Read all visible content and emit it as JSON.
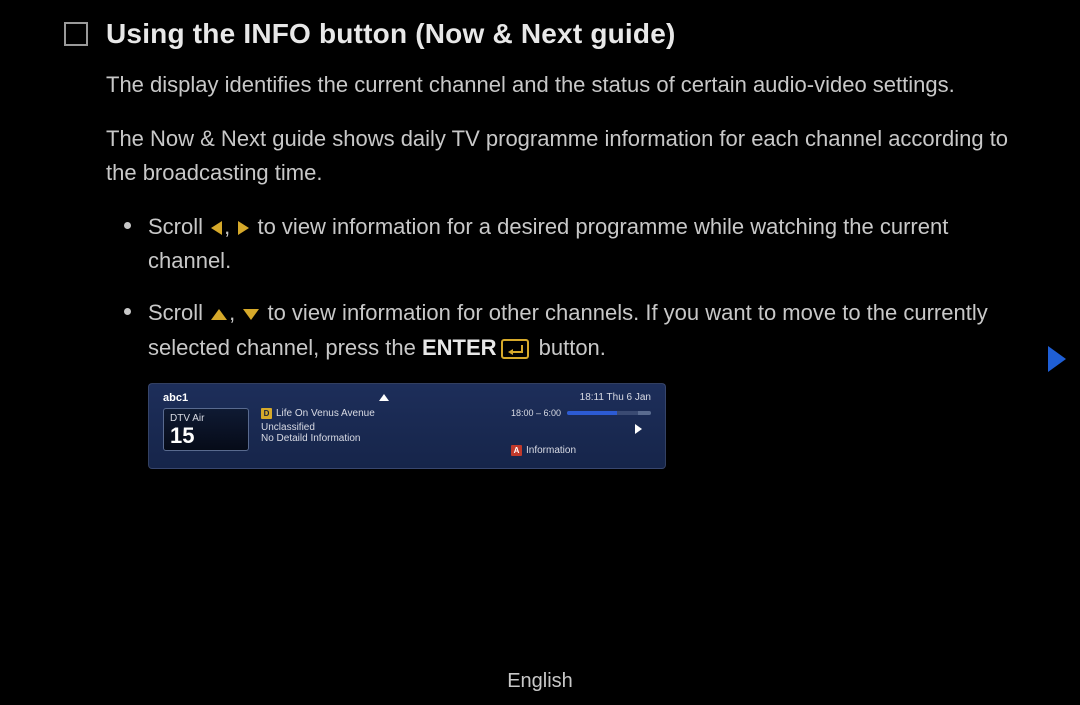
{
  "title": "Using the INFO button (Now & Next guide)",
  "paragraphs": {
    "p1": "The display identifies the current channel and the status of certain audio-video settings.",
    "p2": "The Now & Next guide shows daily TV programme information for each channel according to the broadcasting time."
  },
  "bullets": {
    "b1_pre": "Scroll ",
    "b1_post": " to view information for a desired programme while watching the current channel.",
    "b2_pre": "Scroll ",
    "b2_mid": " to view information for other channels. If you want to move to the currently selected channel, press the ",
    "b2_enter": "ENTER",
    "b2_post": " button."
  },
  "osd": {
    "channel_name": "abc1",
    "clock": "18:11 Thu 6 Jan",
    "source": "DTV Air",
    "channel_number": "15",
    "programme_title": "Life On Venus Avenue",
    "rating": "Unclassified",
    "detail": "No Detaild Information",
    "time_range": "18:00 – 6:00",
    "info_label": "Information"
  },
  "footer": "English"
}
